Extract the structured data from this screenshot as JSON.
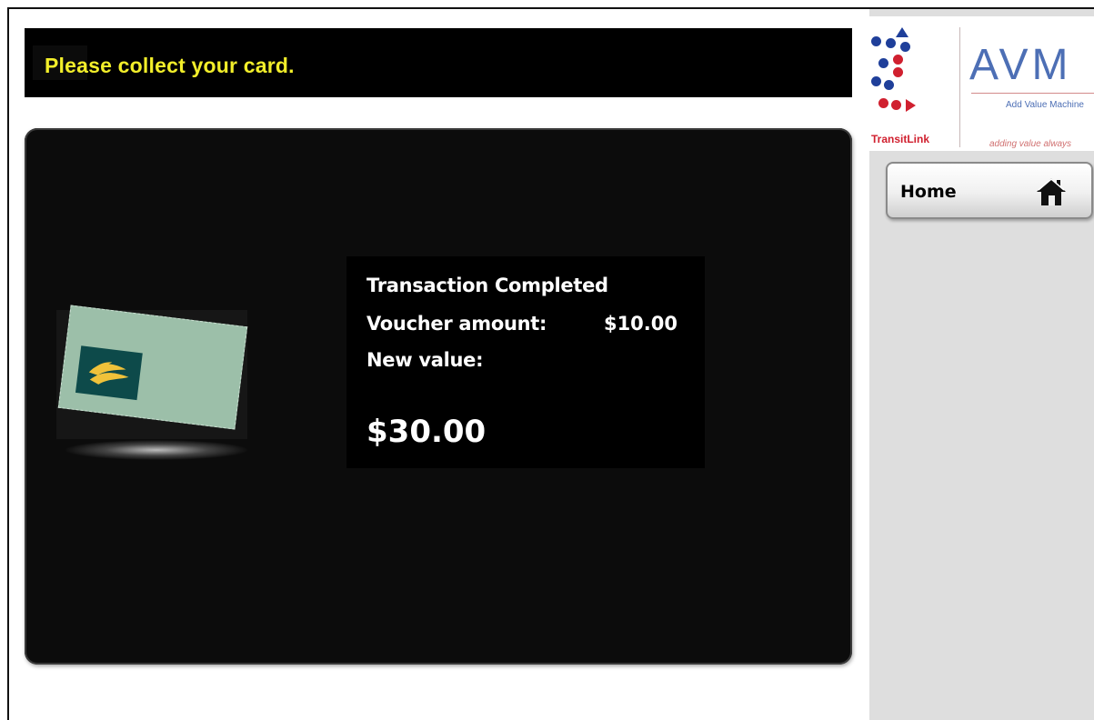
{
  "message": {
    "text": "Please collect your card."
  },
  "transaction": {
    "status": "Transaction Completed",
    "voucher_label": "Voucher amount:",
    "voucher_amount": "$10.00",
    "new_value_label": "New value:",
    "new_value": "$30.00"
  },
  "brand": {
    "left_name": "TransitLink",
    "right_name": "AVM",
    "right_subtitle": "Add Value Machine",
    "right_tagline": "adding value always"
  },
  "nav": {
    "home_label": "Home",
    "home_icon": "home-icon"
  },
  "colors": {
    "message_text": "#f2ee2a",
    "panel_bg": "#0c0c0c",
    "sidebar_bg": "#dedede",
    "card": "#9cbfa9",
    "transitlink_red": "#d0202f",
    "transitlink_blue": "#1f3f9a",
    "avm_blue": "#4d6fb5"
  }
}
